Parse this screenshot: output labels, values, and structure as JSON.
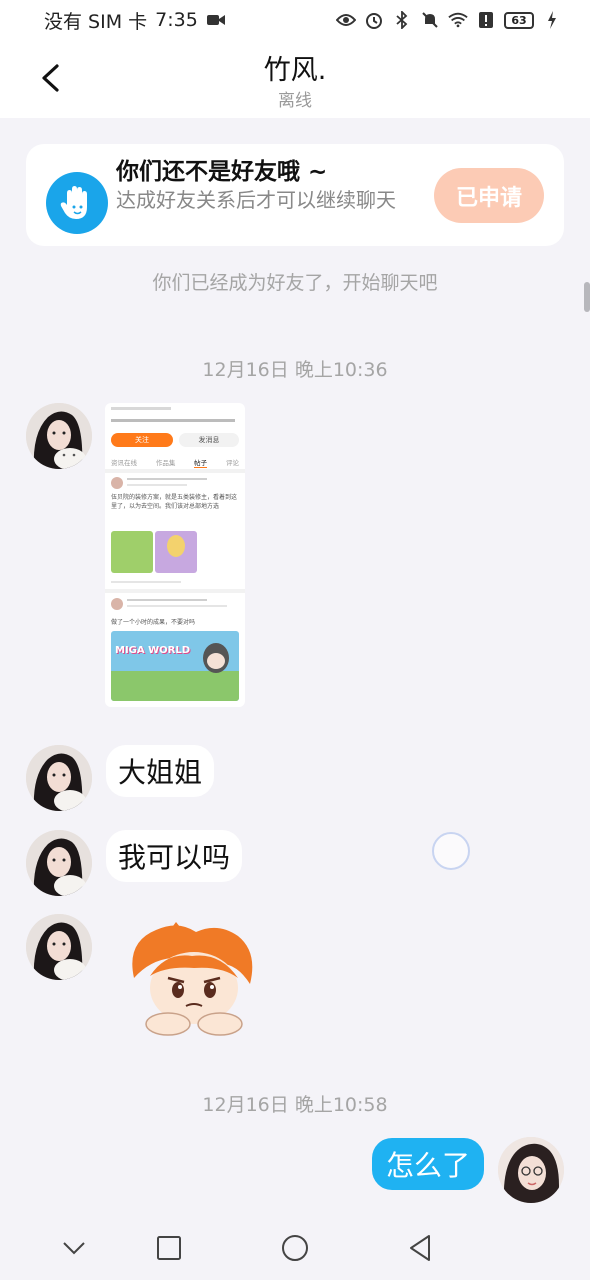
{
  "status_bar": {
    "carrier": "没有 SIM 卡",
    "time": "7:35",
    "battery": "63",
    "icons": [
      "video-icon",
      "eye-icon",
      "alarm-icon",
      "bluetooth-icon",
      "mute-icon",
      "wifi-icon",
      "alert-icon",
      "battery-icon",
      "charging-icon"
    ]
  },
  "header": {
    "title": "竹风.",
    "subtitle": "离线"
  },
  "friend_banner": {
    "title": "你们还不是好友哦 ~",
    "description": "达成好友关系后才可以继续聊天",
    "button_label": "已申请",
    "accent": "#1aa5ea",
    "button_color": "#fccbb5"
  },
  "system_message": "你们已经成为好友了，开始聊天吧",
  "timestamps": {
    "first": "12月16日 晚上10:36",
    "second": "12月16日 晚上10:58"
  },
  "messages": [
    {
      "side": "incoming",
      "type": "image"
    },
    {
      "side": "incoming",
      "type": "text",
      "text": "大姐姐"
    },
    {
      "side": "incoming",
      "type": "text",
      "text": "我可以吗"
    },
    {
      "side": "incoming",
      "type": "sticker"
    },
    {
      "side": "outgoing",
      "type": "text",
      "text": "怎么了"
    }
  ],
  "shared_screenshot": {
    "tab_follow": "关注",
    "tab_message": "发消息",
    "tabs": [
      "资讯在线",
      "作品集",
      "帖子",
      "评论"
    ],
    "post_text": "伍贝院的装修方案，就是五类装修主，看着到这里了，以为去空间。我们该对总部地方选",
    "post2_text": "做了一个小时的成果，不要对吗",
    "game_banner": "MIGA WORLD"
  },
  "colors": {
    "outgoing_bubble": "#1fb2f2",
    "background": "#f4f3f8"
  }
}
